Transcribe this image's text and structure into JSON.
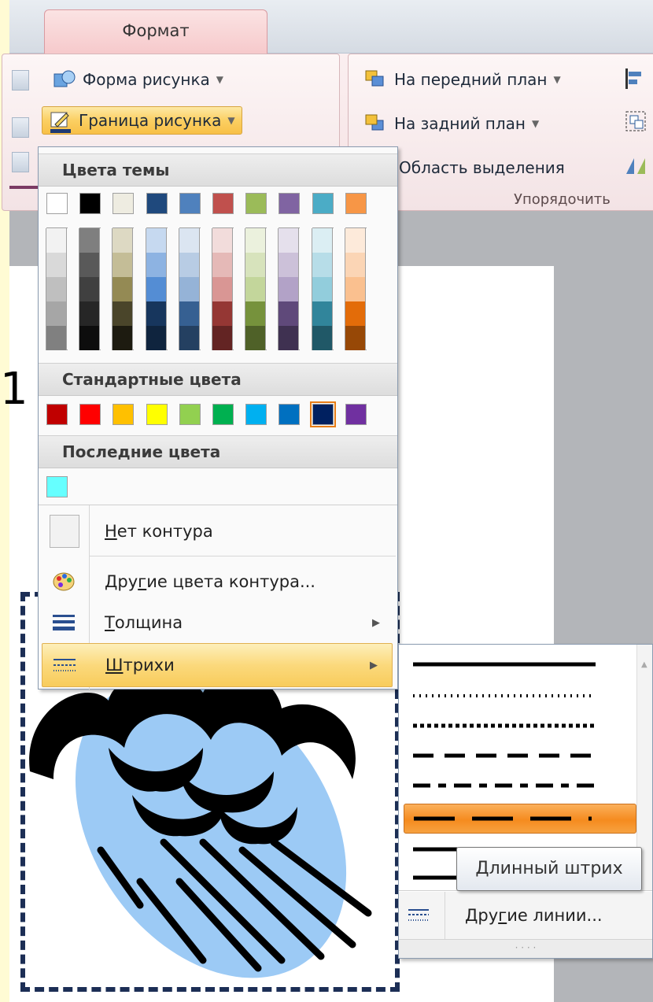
{
  "ribbon": {
    "tab_label": "Формат",
    "shape_button": "Форма рисунка",
    "border_button": "Граница рисунка",
    "bring_forward": "На передний план",
    "send_backward": "На задний план",
    "selection_pane": "Область выделения",
    "arrange_group": "Упорядочить"
  },
  "color_menu": {
    "theme_header": "Цвета темы",
    "standard_header": "Стандартные цвета",
    "recent_header": "Последние цвета",
    "theme_top_row": [
      "#ffffff",
      "#000000",
      "#eeece1",
      "#1f497d",
      "#4f81bd",
      "#c0504d",
      "#9bbb59",
      "#8064a2",
      "#4bacc6",
      "#f79646"
    ],
    "theme_shades": [
      [
        "#f2f2f2",
        "#d9d9d9",
        "#bfbfbf",
        "#a6a6a6",
        "#808080"
      ],
      [
        "#7f7f7f",
        "#595959",
        "#404040",
        "#262626",
        "#0d0d0d"
      ],
      [
        "#ddd9c3",
        "#c4bd97",
        "#948a54",
        "#4a452a",
        "#1d1b10"
      ],
      [
        "#c6d9f0",
        "#8db3e2",
        "#548dd4",
        "#17365d",
        "#0f243e"
      ],
      [
        "#dbe5f1",
        "#b8cce4",
        "#95b3d7",
        "#366092",
        "#244061"
      ],
      [
        "#f2dcdb",
        "#e5b9b7",
        "#d99694",
        "#953734",
        "#632423"
      ],
      [
        "#ebf1dd",
        "#d7e3bc",
        "#c3d69b",
        "#76923c",
        "#4f6128"
      ],
      [
        "#e5e0ec",
        "#ccc1d9",
        "#b2a2c7",
        "#5f497a",
        "#3f3151"
      ],
      [
        "#dbeef3",
        "#b7dde8",
        "#92cddc",
        "#31859b",
        "#205867"
      ],
      [
        "#fdeada",
        "#fbd5b5",
        "#fac08f",
        "#e36c09",
        "#974806"
      ]
    ],
    "standard_colors": [
      "#c00000",
      "#ff0000",
      "#ffc000",
      "#ffff00",
      "#92d050",
      "#00b050",
      "#00b0f0",
      "#0070c0",
      "#002060",
      "#7030a0"
    ],
    "recent_colors": [
      "#66ffff"
    ],
    "no_outline": "Нет контура",
    "no_outline_key": "Н",
    "no_outline_rest": "ет контура",
    "more_colors_pre": "Дру",
    "more_colors_key": "г",
    "more_colors_post": "ие цвета контура...",
    "weight_key": "Т",
    "weight_rest": "олщина",
    "dashes_key": "Ш",
    "dashes_rest": "трихи"
  },
  "dash_menu": {
    "tooltip": "Длинный штрих",
    "more_lines_pre": "Дру",
    "more_lines_key": "г",
    "more_lines_post": "ие линии..."
  },
  "slide": {
    "glyph": "1"
  },
  "colors": {
    "accent_orange": "#f58b1f",
    "frame_dash": "#1c2e55",
    "cloud_blue": "#9ccaf5"
  }
}
